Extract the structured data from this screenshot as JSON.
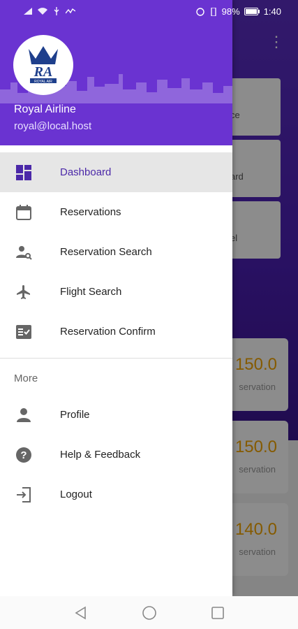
{
  "status_bar": {
    "battery": "98%",
    "time": "1:40"
  },
  "header": {
    "logo_text": "RA",
    "logo_subtext": "ROYAL AIR",
    "name": "Royal Airline",
    "email": "royal@local.host",
    "color": "#6a33d1"
  },
  "menu": {
    "items": [
      {
        "label": "Dashboard",
        "icon": "dashboard-icon",
        "active": true
      },
      {
        "label": "Reservations",
        "icon": "calendar-icon"
      },
      {
        "label": "Reservation Search",
        "icon": "person-search-icon"
      },
      {
        "label": "Flight Search",
        "icon": "airplane-icon"
      },
      {
        "label": "Reservation Confirm",
        "icon": "checklist-icon"
      }
    ],
    "section_title": "More",
    "more_items": [
      {
        "label": "Profile",
        "icon": "person-icon"
      },
      {
        "label": "Help & Feedback",
        "icon": "help-icon"
      },
      {
        "label": "Logout",
        "icon": "logout-icon"
      }
    ]
  },
  "background": {
    "cards": [
      "ce",
      "ard",
      "el"
    ],
    "stats": [
      {
        "value": "150.0",
        "label": "servation"
      },
      {
        "value": "150.0",
        "label": "servation"
      },
      {
        "value": "140.0",
        "label": "servation"
      }
    ]
  },
  "colors": {
    "accent": "#4b28a8",
    "stat": "#f2a500"
  }
}
